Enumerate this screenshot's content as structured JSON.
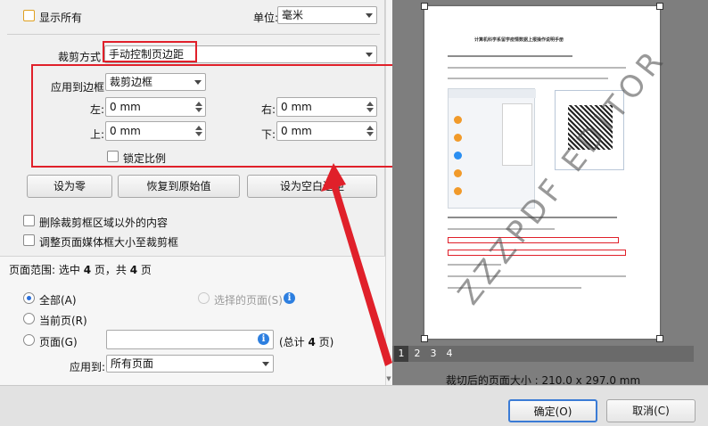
{
  "options": {
    "show_all_label": "显示所有",
    "unit_label": "单位:",
    "unit_value": "毫米",
    "crop_method_label": "裁剪方式",
    "crop_method_value": "手动控制页边距",
    "apply_to_box_label": "应用到边框",
    "apply_to_box_value": "裁剪边框",
    "left_label": "左:",
    "left_value": "0 mm",
    "right_label": "右:",
    "right_value": "0 mm",
    "top_label": "上:",
    "top_value": "0 mm",
    "bottom_label": "下:",
    "bottom_value": "0 mm",
    "lock_ratio_label": "锁定比例",
    "set_zero_button": "设为零",
    "restore_button": "恢复到原始值",
    "set_white_margin_button": "设为空白边距",
    "delete_outside_label": "删除裁剪框区域以外的内容",
    "resize_mediabox_label": "调整页面媒体框大小至裁剪框"
  },
  "page_range": {
    "header_prefix": "页面范围: 选中 ",
    "selected_count": "4",
    "header_mid": " 页，共 ",
    "total_count": "4",
    "header_suffix": " 页",
    "all_label": "全部(A)",
    "selected_pages_label": "选择的页面(S)",
    "current_page_label": "当前页(R)",
    "pages_label": "页面(G)",
    "pages_input_value": "",
    "total_prefix": "(总计 ",
    "total_suffix": " 页)",
    "apply_to_label": "应用到:",
    "apply_to_value": "所有页面"
  },
  "preview": {
    "page_numbers": [
      "1",
      "2",
      "3",
      "4"
    ],
    "current_page": "1",
    "crop_size_label": "裁切后的页面大小 : 210.0 x 297.0 mm",
    "watermark_text": "ZZZPDF EDITOR",
    "doc_title": "计算机科学系留学疫情数据上报操作说明手册"
  },
  "dialog": {
    "ok_button": "确定(O)",
    "cancel_button": "取消(C)"
  },
  "colors": {
    "highlight": "#e0202a",
    "radio_selected": "#2a6fdb",
    "info": "#2d7fe0"
  }
}
